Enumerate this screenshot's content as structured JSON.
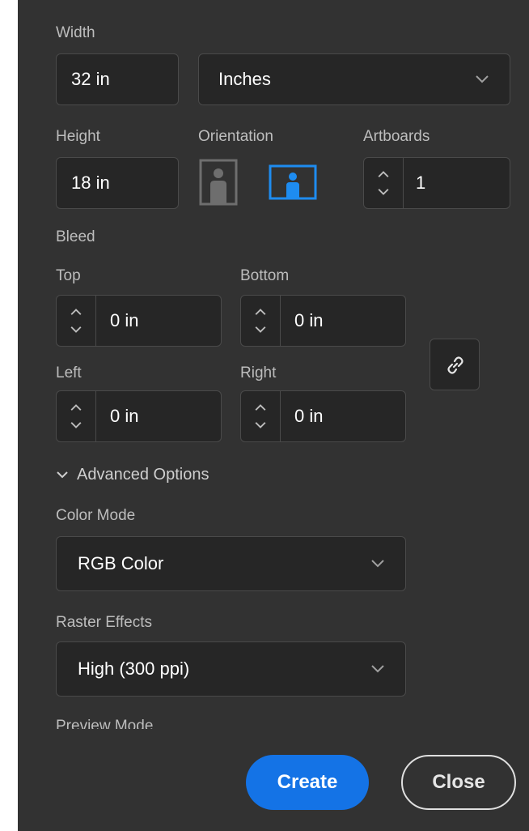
{
  "width": {
    "label": "Width",
    "value": "32 in"
  },
  "units": {
    "value": "Inches"
  },
  "height": {
    "label": "Height",
    "value": "18 in"
  },
  "orientation": {
    "label": "Orientation",
    "selected": "landscape"
  },
  "artboards": {
    "label": "Artboards",
    "value": "1"
  },
  "bleed": {
    "label": "Bleed",
    "top": {
      "label": "Top",
      "value": "0 in"
    },
    "bottom": {
      "label": "Bottom",
      "value": "0 in"
    },
    "left": {
      "label": "Left",
      "value": "0 in"
    },
    "right": {
      "label": "Right",
      "value": "0 in"
    },
    "link_icon": "link-icon"
  },
  "advanced": {
    "label": "Advanced Options",
    "color_mode": {
      "label": "Color Mode",
      "value": "RGB Color"
    },
    "raster_effects": {
      "label": "Raster Effects",
      "value": "High (300 ppi)"
    },
    "preview_mode": {
      "label": "Preview Mode"
    }
  },
  "actions": {
    "create_label": "Create",
    "close_label": "Close"
  },
  "colors": {
    "panel": "#323232",
    "field": "#262626",
    "accent": "#1473e6",
    "text": "#ffffff",
    "label": "#bdbdbd"
  }
}
